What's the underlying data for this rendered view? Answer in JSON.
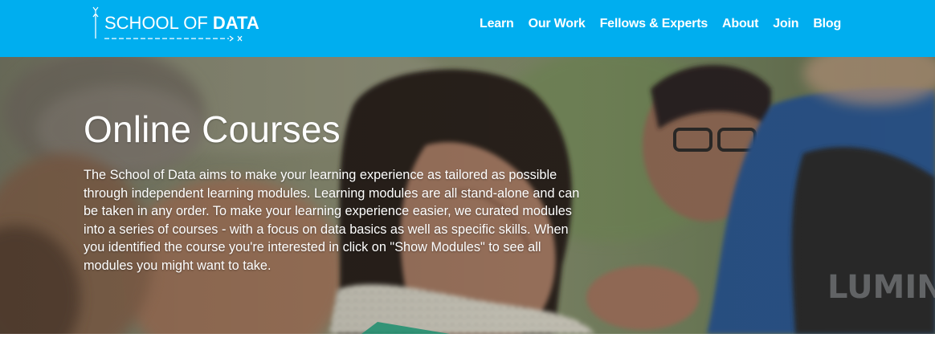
{
  "brand": {
    "name_light": "SCHOOL OF ",
    "name_bold": "DATA",
    "color": "#00aeef"
  },
  "nav": {
    "items": [
      {
        "label": "Learn"
      },
      {
        "label": "Our Work"
      },
      {
        "label": "Fellows & Experts"
      },
      {
        "label": "About"
      },
      {
        "label": "Join"
      },
      {
        "label": "Blog"
      }
    ]
  },
  "hero": {
    "title": "Online Courses",
    "body": "The School of Data aims to make your learning experience as tailored as possible through independent learning modules. Learning modules are all stand-alone and can be taken in any order. To make your learning experience easier, we curated modules into a series of courses - with a focus on data basics as well as specific skills. When you identified the course you're interested in click on \"Show Modules\" to see all modules you might want to take."
  }
}
